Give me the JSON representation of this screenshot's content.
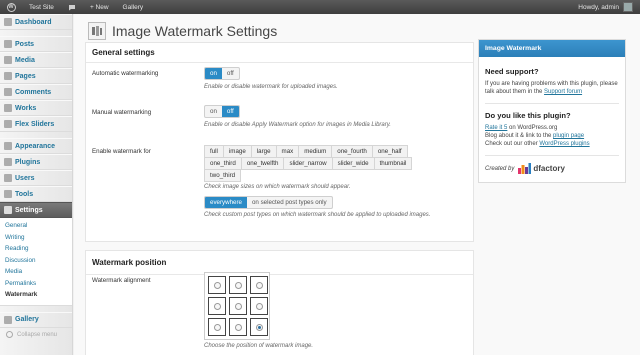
{
  "adminbar": {
    "site_name": "Test Site",
    "comments_count": "",
    "new_label": "+ New",
    "gallery_label": "Gallery",
    "howdy": "Howdy, admin"
  },
  "sidebar": {
    "items": [
      {
        "label": "Dashboard",
        "icon": "dashboard-icon"
      },
      {
        "label": "Posts",
        "icon": "pin-icon"
      },
      {
        "label": "Media",
        "icon": "media-icon"
      },
      {
        "label": "Pages",
        "icon": "pages-icon"
      },
      {
        "label": "Comments",
        "icon": "comments-icon"
      },
      {
        "label": "Works",
        "icon": "works-icon"
      },
      {
        "label": "Flex Sliders",
        "icon": "slider-icon"
      },
      {
        "label": "Appearance",
        "icon": "appearance-icon"
      },
      {
        "label": "Plugins",
        "icon": "plugins-icon"
      },
      {
        "label": "Users",
        "icon": "users-icon"
      },
      {
        "label": "Tools",
        "icon": "tools-icon"
      },
      {
        "label": "Settings",
        "icon": "settings-icon"
      }
    ],
    "submenu": [
      "General",
      "Writing",
      "Reading",
      "Discussion",
      "Media",
      "Permalinks",
      "Watermark"
    ],
    "gallery": "Gallery",
    "collapse": "Collapse menu"
  },
  "page": {
    "title": "Image Watermark Settings"
  },
  "general": {
    "heading": "General settings",
    "auto_label": "Automatic watermarking",
    "auto_on": "on",
    "auto_off": "off",
    "auto_desc": "Enable or disable watermark for uploaded images.",
    "manual_label": "Manual watermarking",
    "manual_on": "on",
    "manual_off": "off",
    "manual_desc": "Enable or disable Apply Watermark option for images in Media Library.",
    "enable_label": "Enable watermark for",
    "sizes": [
      "full",
      "image",
      "large",
      "max",
      "medium",
      "one_fourth",
      "one_half",
      "one_third",
      "one_twelfth",
      "slider_narrow",
      "slider_wide",
      "thumbnail",
      "two_third"
    ],
    "sizes_desc": "Check image sizes on which watermark should appear.",
    "everywhere": "everywhere",
    "selected_types": "on selected post types only",
    "types_desc": "Check custom post types on which watermark should be applied to uploaded images."
  },
  "position": {
    "heading": "Watermark position",
    "alignment_label": "Watermark alignment",
    "selected_index": 8,
    "desc": "Choose the position of watermark image."
  },
  "widget": {
    "header": "Image Watermark",
    "support_title": "Need support?",
    "support_text": "If you are having problems with this plugin, please talk about them in the",
    "support_link": "Support forum",
    "like_title": "Do you like this plugin?",
    "rate_link": "Rate it 5",
    "rate_suffix": "on WordPress.org",
    "blog_text": "Blog about it & link to the",
    "plugin_page_link": "plugin page",
    "check_text": "Check out our other",
    "plugins_link": "WordPress plugins",
    "created_by": "Created by",
    "brand": "dfactory"
  },
  "colors": {
    "accent": "#2b8bc6",
    "link": "#21759b",
    "current_menu": "#6b6b6b"
  }
}
